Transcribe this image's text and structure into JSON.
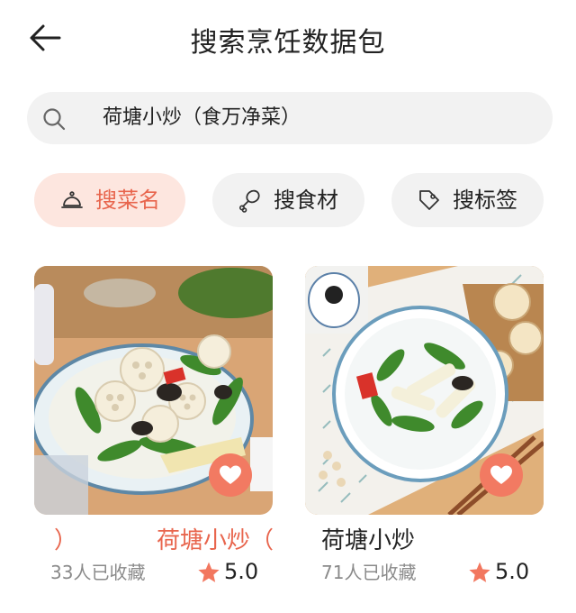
{
  "header": {
    "title": "搜索烹饪数据包"
  },
  "search": {
    "value": "荷塘小炒（食万净菜）"
  },
  "chips": [
    {
      "label": "搜菜名",
      "icon": "cloche-icon",
      "active": true
    },
    {
      "label": "搜食材",
      "icon": "drumstick-icon",
      "active": false
    },
    {
      "label": "搜标签",
      "icon": "tag-icon",
      "active": false
    }
  ],
  "cards": [
    {
      "name_left": "）",
      "name_right": "荷塘小炒（",
      "favorites": "33人已收藏",
      "rating": "5.0"
    },
    {
      "name": "荷塘小炒",
      "favorites": "71人已收藏",
      "rating": "5.0"
    }
  ],
  "colors": {
    "accent": "#e8654d",
    "chip_active_bg": "#fde6df",
    "chip_bg": "#f2f2f2",
    "heart_bg": "#f27a62",
    "star": "#f2775f"
  }
}
